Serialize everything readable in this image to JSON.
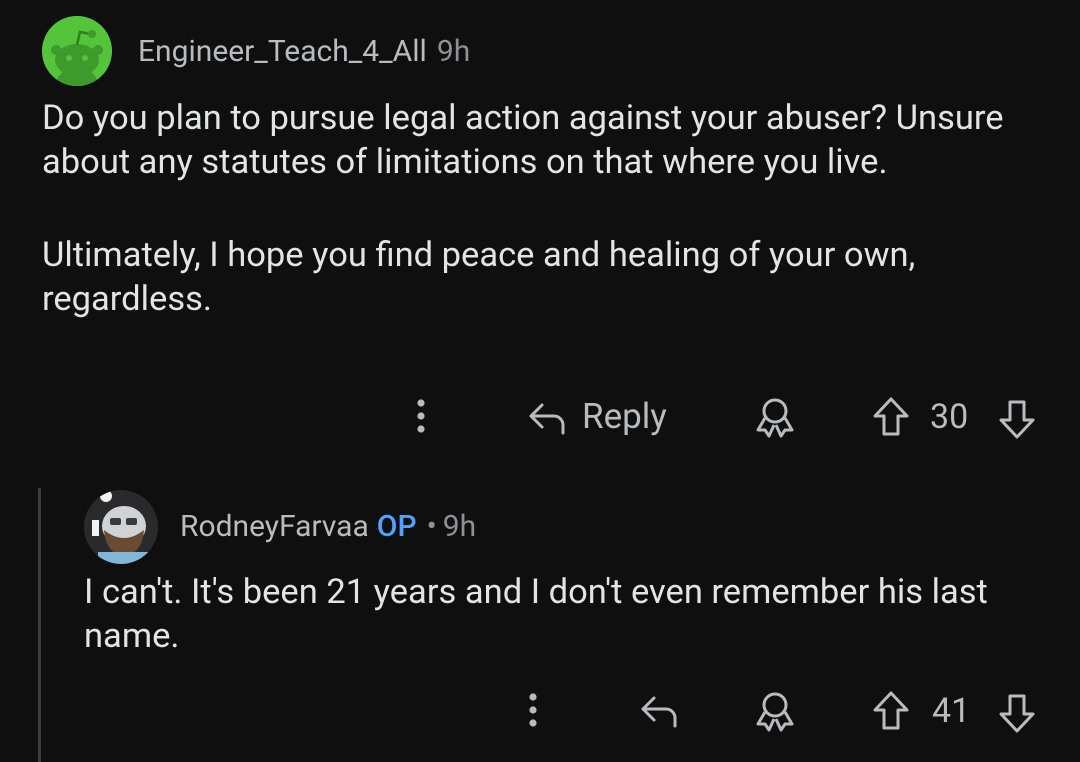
{
  "comment": {
    "username": "Engineer_Teach_4_All",
    "time": "9h",
    "paragraphs": [
      "Do you plan to pursue legal action against your abuser? Unsure about any statutes of limitations on that where you live.",
      "Ultimately, I hope you find peace and healing of your own, regardless."
    ],
    "reply_label": "Reply",
    "vote_count": "30",
    "avatar_color": "#54c43b"
  },
  "reply": {
    "username": "RodneyFarvaa",
    "op_badge": "OP",
    "separator": "•",
    "time": "9h",
    "text": "I can't. It's been 21 years and I don't even remember his last name.",
    "vote_count": "41"
  },
  "colors": {
    "background": "#0f0f0f",
    "text": "#e3e4e6",
    "meta": "#9a9ea3",
    "op_badge": "#4fa3ff",
    "thread_line": "#3c3c3e"
  },
  "icons": [
    "more-vertical-icon",
    "reply-arrow-icon",
    "award-icon",
    "upvote-icon",
    "downvote-icon"
  ]
}
